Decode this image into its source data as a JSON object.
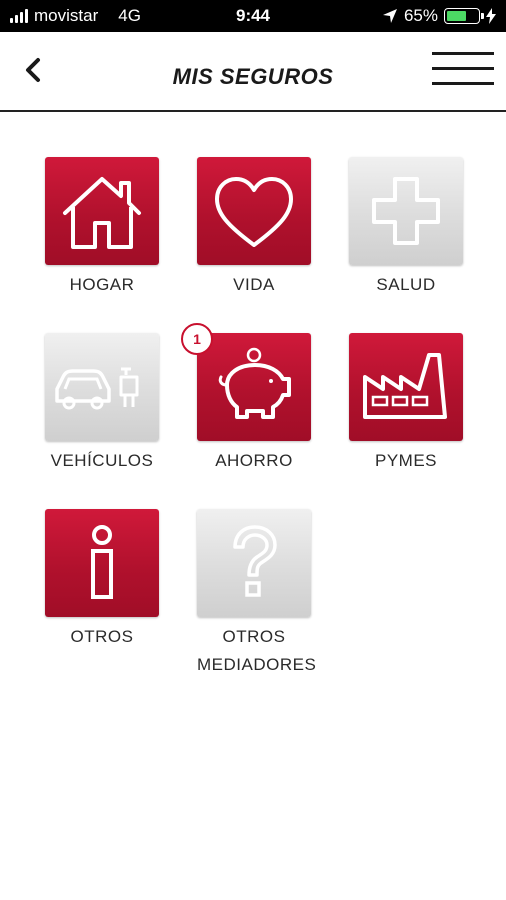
{
  "status_bar": {
    "carrier": "movistar",
    "network": "4G",
    "time": "9:44",
    "battery": "65%",
    "battery_level": 0.65
  },
  "header": {
    "title": "MIS SEGUROS"
  },
  "tiles": [
    {
      "label": "HOGAR",
      "icon": "house-icon",
      "active": true
    },
    {
      "label": "VIDA",
      "icon": "heart-icon",
      "active": true
    },
    {
      "label": "SALUD",
      "icon": "cross-icon",
      "active": false
    },
    {
      "label": "VEHÍCULOS",
      "icon": "car-scooter-icon",
      "active": false
    },
    {
      "label": "AHORRO",
      "icon": "piggy-bank-icon",
      "active": true,
      "badge": "1"
    },
    {
      "label": "PYMES",
      "icon": "factory-icon",
      "active": true
    },
    {
      "label": "OTROS",
      "icon": "info-icon",
      "active": true
    },
    {
      "label": "OTROS MEDIADORES",
      "label_line1": "OTROS",
      "label_line2": "MEDIADORES",
      "icon": "question-icon",
      "active": false
    }
  ],
  "colors": {
    "brand_red": "#c8102e",
    "inactive_grey": "#d9d9d9",
    "battery_green": "#4cd964"
  }
}
